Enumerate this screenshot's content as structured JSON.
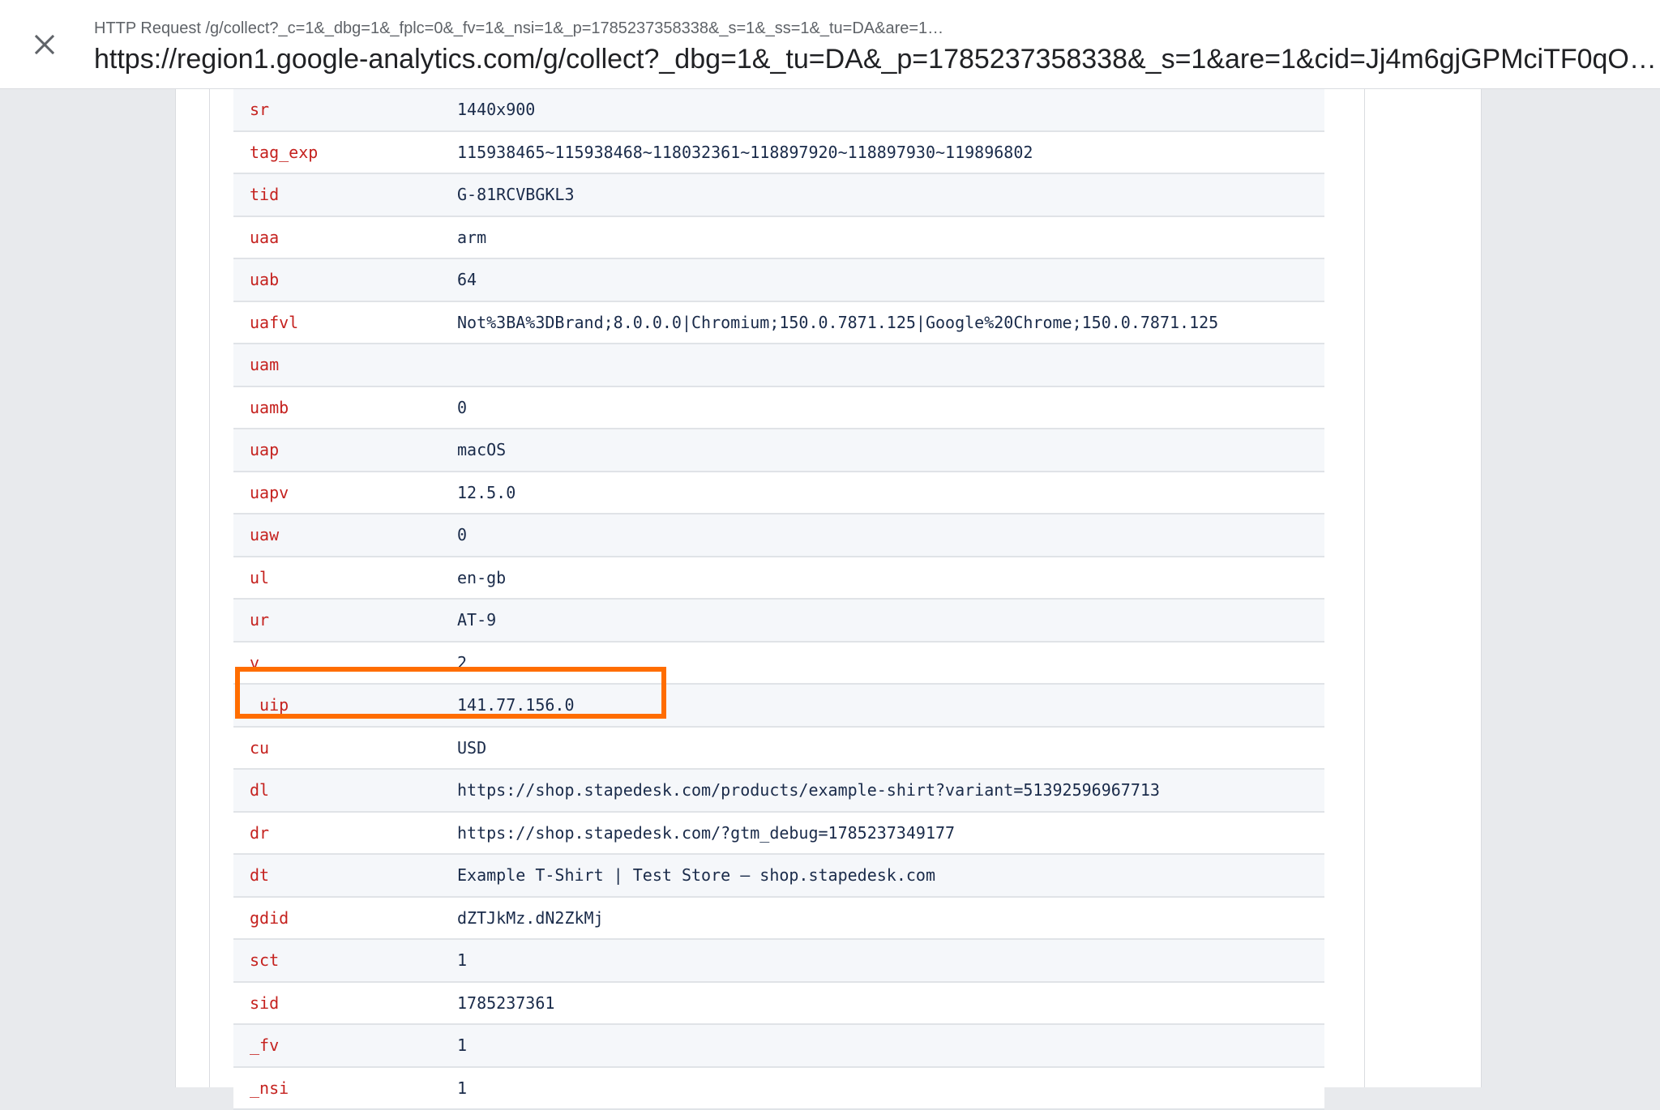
{
  "header": {
    "subtitle": "HTTP Request /g/collect?_c=1&_dbg=1&_fplc=0&_fv=1&_nsi=1&_p=1785237358338&_s=1&_ss=1&_tu=DA&are=1…",
    "title": "https://region1.google-analytics.com/g/collect?_dbg=1&_tu=DA&_p=1785237358338&_s=1&are=1&cid=Jj4m6gjGPMciTF0qOU…",
    "close_icon": "close-icon"
  },
  "colors": {
    "key": "#c5221f",
    "value": "#1a2b4a",
    "highlight": "#ff6d00"
  },
  "params": [
    {
      "key": "sr",
      "value": "1440x900"
    },
    {
      "key": "tag_exp",
      "value": "115938465~115938468~118032361~118897920~118897930~119896802"
    },
    {
      "key": "tid",
      "value": "G-81RCVBGKL3"
    },
    {
      "key": "uaa",
      "value": "arm"
    },
    {
      "key": "uab",
      "value": "64"
    },
    {
      "key": "uafvl",
      "value": "Not%3BA%3DBrand;8.0.0.0|Chromium;150.0.7871.125|Google%20Chrome;150.0.7871.125"
    },
    {
      "key": "uam",
      "value": ""
    },
    {
      "key": "uamb",
      "value": "0"
    },
    {
      "key": "uap",
      "value": "macOS"
    },
    {
      "key": "uapv",
      "value": "12.5.0"
    },
    {
      "key": "uaw",
      "value": "0"
    },
    {
      "key": "ul",
      "value": "en-gb"
    },
    {
      "key": "ur",
      "value": "AT-9"
    },
    {
      "key": "v",
      "value": "2"
    },
    {
      "key": "_uip",
      "value": "141.77.156.0"
    },
    {
      "key": "cu",
      "value": "USD"
    },
    {
      "key": "dl",
      "value": "https://shop.stapedesk.com/products/example-shirt?variant=51392596967713"
    },
    {
      "key": "dr",
      "value": "https://shop.stapedesk.com/?gtm_debug=1785237349177"
    },
    {
      "key": "dt",
      "value": "Example T-Shirt | Test Store – shop.stapedesk.com"
    },
    {
      "key": "gdid",
      "value": "dZTJkMz.dN2ZkMj"
    },
    {
      "key": "sct",
      "value": "1"
    },
    {
      "key": "sid",
      "value": "1785237361"
    },
    {
      "key": "_fv",
      "value": "1"
    },
    {
      "key": "_nsi",
      "value": "1"
    }
  ]
}
